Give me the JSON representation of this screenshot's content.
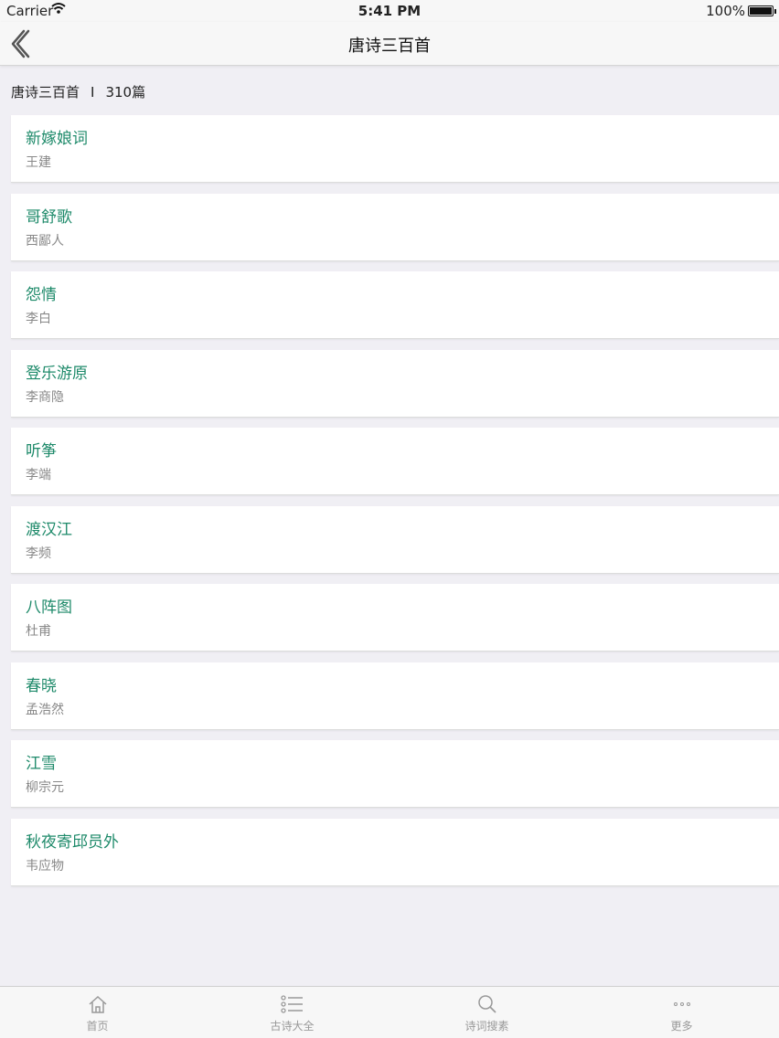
{
  "status_bar": {
    "carrier": "Carrier",
    "time": "5:41 PM",
    "battery": "100%"
  },
  "nav": {
    "title": "唐诗三百首",
    "back_icon": "chevron-left-icon"
  },
  "section": {
    "collection": "唐诗三百首",
    "separator": "I",
    "count": "310篇"
  },
  "poems": [
    {
      "title": "新嫁娘词",
      "author": "王建"
    },
    {
      "title": "哥舒歌",
      "author": "西鄙人"
    },
    {
      "title": "怨情",
      "author": "李白"
    },
    {
      "title": "登乐游原",
      "author": "李商隐"
    },
    {
      "title": "听筝",
      "author": "李端"
    },
    {
      "title": "渡汉江",
      "author": "李频"
    },
    {
      "title": "八阵图",
      "author": "杜甫"
    },
    {
      "title": "春晓",
      "author": "孟浩然"
    },
    {
      "title": "江雪",
      "author": "柳宗元"
    },
    {
      "title": "秋夜寄邱员外",
      "author": "韦应物"
    }
  ],
  "tabs": [
    {
      "label": "首页",
      "icon": "home-icon"
    },
    {
      "label": "古诗大全",
      "icon": "list-icon"
    },
    {
      "label": "诗词搜素",
      "icon": "search-icon"
    },
    {
      "label": "更多",
      "icon": "more-icon"
    }
  ],
  "colors": {
    "accent": "#1e8a6a",
    "background": "#f0eff4",
    "author": "#888888"
  }
}
